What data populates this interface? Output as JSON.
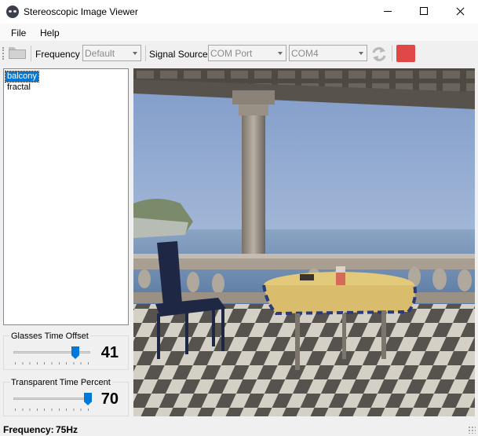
{
  "window": {
    "title": "Stereoscopic Image Viewer",
    "icon": "stereo-glasses-icon"
  },
  "menu": {
    "items": [
      "File",
      "Help"
    ]
  },
  "toolbar": {
    "open_icon": "folder-open-icon",
    "frequency_label": "Frequency",
    "frequency_value": "Default",
    "signal_source_label": "Signal Source",
    "signal_source_value": "COM Port",
    "port_value": "COM4",
    "refresh_icon": "refresh-icon",
    "stop_icon": "stop-icon",
    "stop_color": "#e04848"
  },
  "image_list": {
    "items": [
      "balcony",
      "fractal"
    ],
    "selected": "balcony"
  },
  "glasses_offset": {
    "title": "Glasses Time Offset",
    "value": "41"
  },
  "transparent_percent": {
    "title": "Transparent Time Percent",
    "value": "70"
  },
  "status": {
    "label": "Frequency:",
    "value": "75Hz"
  },
  "colors": {
    "selection": "#0078d7",
    "slider_thumb": "#0078d7"
  }
}
